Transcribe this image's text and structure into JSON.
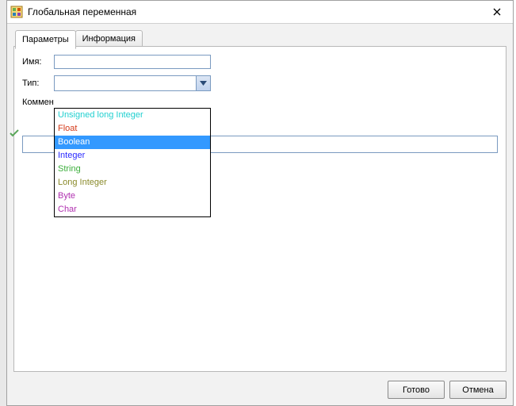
{
  "window": {
    "title": "Глобальная переменная"
  },
  "tabs": {
    "parameters": "Параметры",
    "information": "Информация"
  },
  "labels": {
    "name": "Имя:",
    "type": "Тип:",
    "comment_short": "Коммен"
  },
  "fields": {
    "name_value": "",
    "type_value": "",
    "comment_value": ""
  },
  "type_options": [
    {
      "label": "Unsigned long Integer",
      "cls": "c-uli"
    },
    {
      "label": "Float",
      "cls": "c-float"
    },
    {
      "label": "Boolean",
      "cls": "c-bool",
      "selected": true
    },
    {
      "label": "Integer",
      "cls": "c-int"
    },
    {
      "label": "String",
      "cls": "c-str"
    },
    {
      "label": "Long Integer",
      "cls": "c-long"
    },
    {
      "label": "Byte",
      "cls": "c-byte"
    },
    {
      "label": "Char",
      "cls": "c-char"
    }
  ],
  "buttons": {
    "ok": "Готово",
    "cancel": "Отмена"
  }
}
